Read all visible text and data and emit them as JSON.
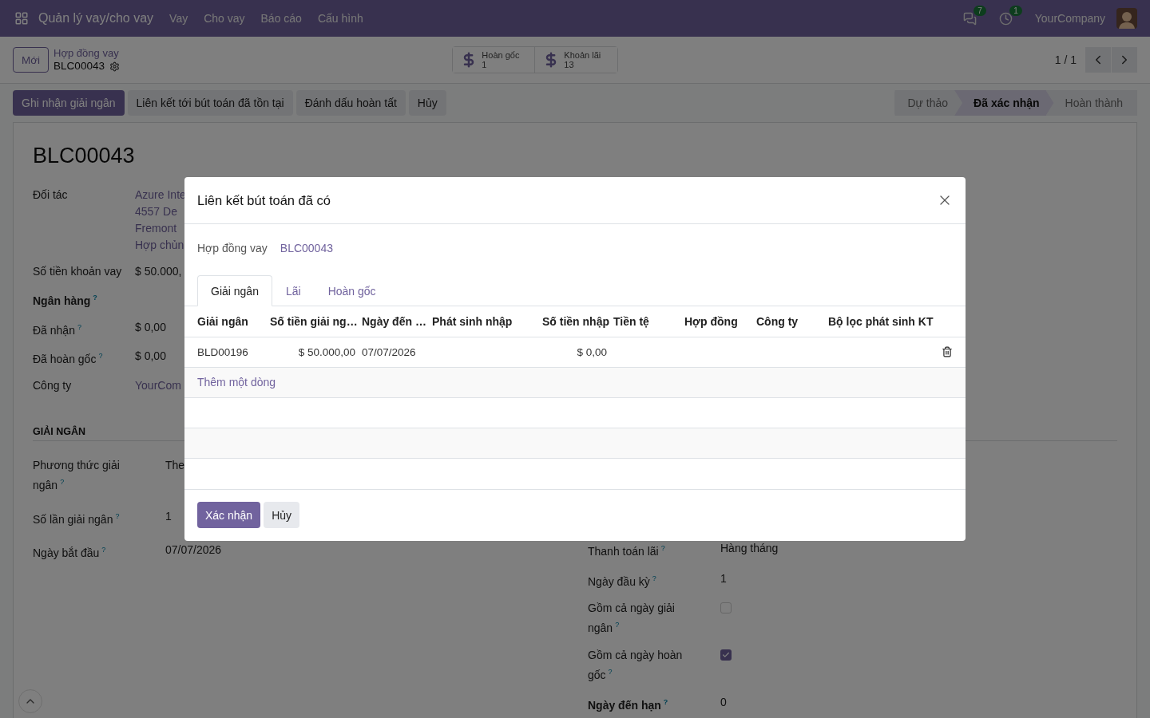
{
  "navbar": {
    "app_title": "Quản lý vay/cho vay",
    "menu": [
      "Vay",
      "Cho vay",
      "Báo cáo",
      "Cấu hình"
    ],
    "messages_count": "7",
    "activities_count": "1",
    "company": "YourCompany"
  },
  "control_panel": {
    "new_button": "Mới",
    "breadcrumb": "Hợp đồng vay",
    "record": "BLC00043",
    "smart_buttons": [
      {
        "label": "Hoàn gốc",
        "value": "1"
      },
      {
        "label": "Khoản lãi",
        "value": "13"
      }
    ],
    "pager": "1 / 1"
  },
  "actions": [
    {
      "label": "Ghi nhận giải ngân",
      "primary": true
    },
    {
      "label": "Liên kết tới bút toán đã tồn tại",
      "primary": false
    },
    {
      "label": "Đánh dấu hoàn tất",
      "primary": false
    },
    {
      "label": "Hủy",
      "primary": false
    }
  ],
  "statusbar": [
    {
      "label": "Dự thảo",
      "selected": false
    },
    {
      "label": "Đã xác nhận",
      "selected": true
    },
    {
      "label": "Hoàn thành",
      "selected": false
    }
  ],
  "form": {
    "title": "BLC00043",
    "main_fields": [
      {
        "label": "Đối tác",
        "values": [
          "Azure Inte",
          "4557 De",
          "Fremont",
          "Hợp chủn"
        ],
        "link": true,
        "bold": false
      },
      {
        "label": "Số tiền khoản vay",
        "values": [
          "$ 50.000,"
        ],
        "link": false,
        "bold": false
      },
      {
        "label": "Ngân hàng",
        "help": "?",
        "bold": true
      },
      {
        "label": "Đã nhận",
        "help": "?",
        "values": [
          "$ 0,00"
        ],
        "link": false,
        "bold": false
      },
      {
        "label": "Đã hoàn gốc",
        "help": "?",
        "values": [
          "$ 0,00"
        ],
        "link": false,
        "bold": false
      },
      {
        "label": "Công ty",
        "values": [
          "YourCom"
        ],
        "link": true,
        "bold": false
      }
    ],
    "section": "GIẢI NGÂN",
    "left_fields": [
      {
        "label": "Phương thức giải ngân",
        "help": "?",
        "value": "The",
        "kind": "text",
        "bold": false
      },
      {
        "label": "Số lần giải ngân",
        "help": "?",
        "value": "1",
        "kind": "text",
        "bold": false
      },
      {
        "label": "Ngày bắt đầu",
        "help": "?",
        "value": "07/07/2026",
        "kind": "text",
        "bold": false
      }
    ],
    "right_fields": [
      {
        "label": "Thanh toán lãi",
        "help": "?",
        "value": "Hàng tháng",
        "kind": "text",
        "bold": false
      },
      {
        "label": "Ngày đầu kỳ",
        "help": "?",
        "value": "1",
        "kind": "text",
        "bold": false
      },
      {
        "label": "Gồm cả ngày giải ngân",
        "help": "?",
        "kind": "checkbox",
        "checked": false,
        "bold": false
      },
      {
        "label": "Gồm cả ngày hoàn gốc",
        "help": "?",
        "kind": "checkbox",
        "checked": true,
        "bold": false
      },
      {
        "label": "Ngày đến hạn",
        "help": "?",
        "value": "0",
        "kind": "text",
        "bold": true
      }
    ]
  },
  "dialog": {
    "title": "Liên kết bút toán đã có",
    "contract_label": "Hợp đồng vay",
    "contract_value": "BLC00043",
    "tabs": [
      {
        "label": "Giải ngân",
        "selected": true
      },
      {
        "label": "Lãi",
        "selected": false
      },
      {
        "label": "Hoàn gốc",
        "selected": false
      }
    ],
    "columns": [
      {
        "label": "Giải ngân",
        "kind": "text"
      },
      {
        "label": "Số tiền giải ng…",
        "kind": "amount"
      },
      {
        "label": "Ngày đến …",
        "kind": "text"
      },
      {
        "label": "Phát sinh nhập",
        "kind": "text"
      },
      {
        "label": "Số tiền nhập",
        "kind": "amount"
      },
      {
        "label": "Tiền tệ",
        "kind": "text"
      },
      {
        "label": "Hợp đồng",
        "kind": "text"
      },
      {
        "label": "Công ty",
        "kind": "text"
      },
      {
        "label": "Bộ lọc phát sinh KT",
        "kind": "text"
      }
    ],
    "rows": [
      {
        "cells": [
          "BLD00196",
          "$ 50.000,00",
          "07/07/2026",
          "",
          "$ 0,00",
          "",
          "",
          "",
          ""
        ]
      }
    ],
    "add_line": "Thêm một dòng",
    "buttons": [
      {
        "label": "Xác nhận",
        "primary": true
      },
      {
        "label": "Hủy",
        "primary": false
      }
    ]
  }
}
